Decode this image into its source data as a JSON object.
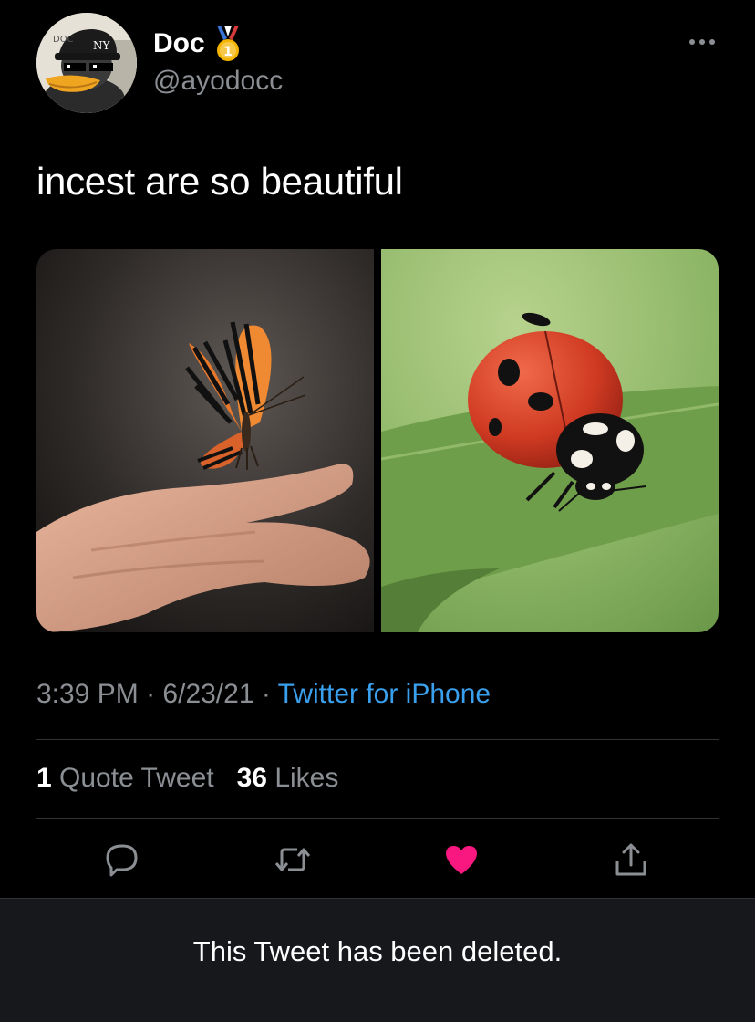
{
  "author": {
    "display_name": "Doc",
    "handle": "@ayodocc",
    "badge": "first-place-medal-icon",
    "avatar_cap_text": "NY",
    "avatar_logo_text": "DOC"
  },
  "tweet": {
    "text": "incest are so beautiful",
    "media": [
      {
        "subject": "butterfly-on-hand"
      },
      {
        "subject": "ladybug-on-leaf"
      }
    ],
    "time": "3:39 PM",
    "date": "6/23/21",
    "separator": "·",
    "source": "Twitter for iPhone"
  },
  "stats": {
    "quote_count": "1",
    "quote_label": "Quote Tweet",
    "like_count": "36",
    "like_label": "Likes"
  },
  "actions": {
    "reply_icon": "reply-icon",
    "retweet_icon": "retweet-icon",
    "like_icon": "heart-icon",
    "share_icon": "share-icon"
  },
  "banner": {
    "deleted_text": "This Tweet has been deleted."
  },
  "colors": {
    "background": "#000000",
    "link": "#3a9fec",
    "muted": "#8b8f94",
    "like": "#f91880",
    "banner_bg": "#16181c"
  }
}
